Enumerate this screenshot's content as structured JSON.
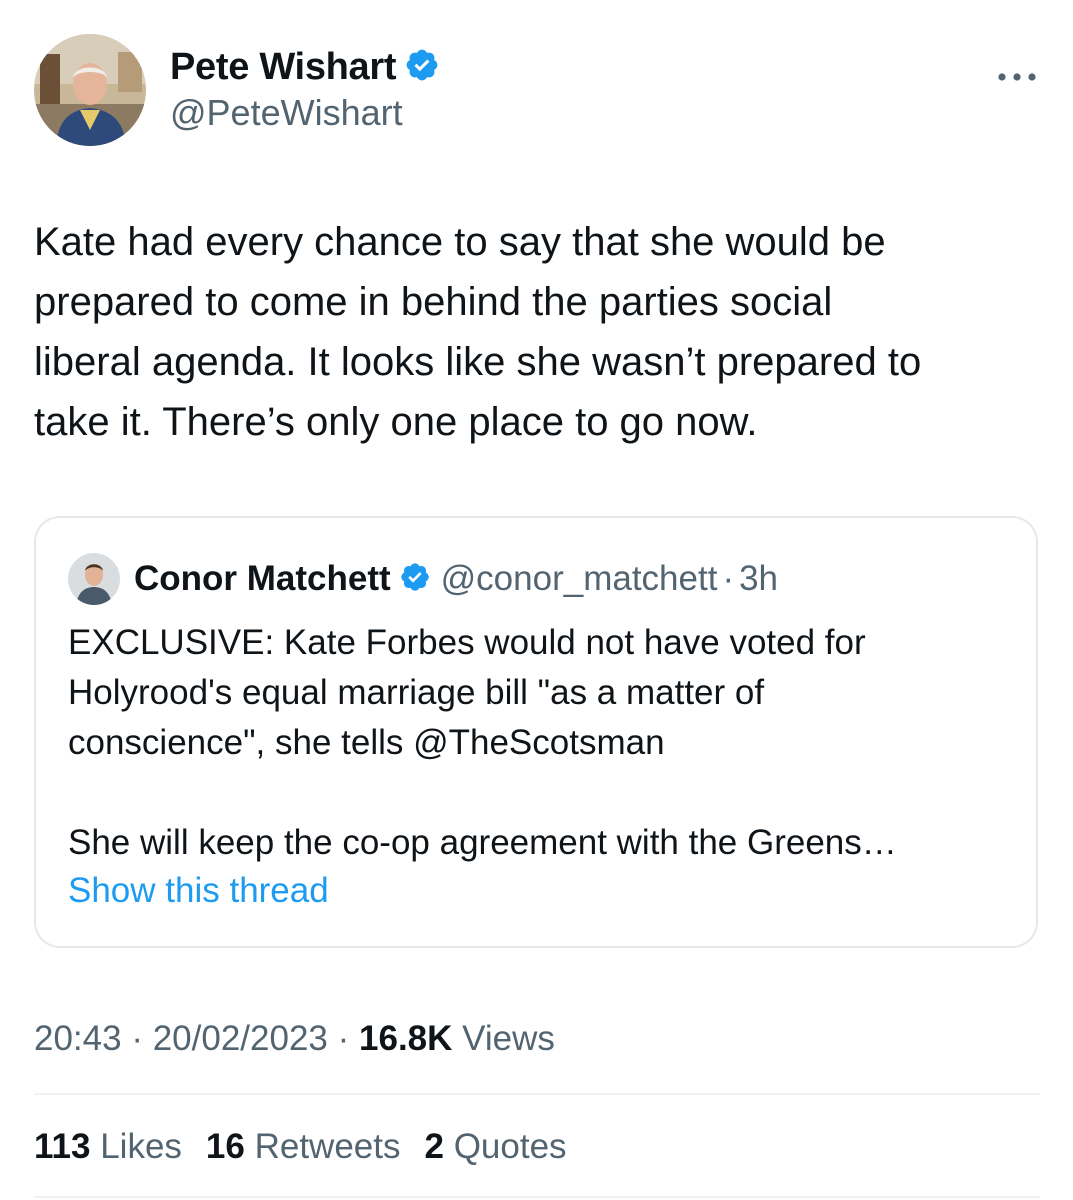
{
  "author": {
    "name": "Pete Wishart",
    "handle": "@PeteWishart",
    "verified": true
  },
  "tweet": {
    "text": "Kate had every chance to say that she would be\nprepared to come in behind the parties social\nliberal agenda. It looks like she wasn’t prepared to\ntake it. There’s only one place to go now."
  },
  "quoted_tweet": {
    "name": "Conor Matchett",
    "handle": "@conor_matchett",
    "separator": "·",
    "time": "3h",
    "verified": true,
    "text": "EXCLUSIVE: Kate Forbes would not have voted for\nHolyrood's equal marriage bill \"as a matter of\nconscience\", she tells @TheScotsman\n\nShe will keep the co-op agreement with the Greens…",
    "show_thread": "Show this thread"
  },
  "meta": {
    "time": "20:43",
    "sep1": "·",
    "date": "20/02/2023",
    "sep2": "·",
    "views_count": "16.8K",
    "views_label": "Views"
  },
  "stats": {
    "likes_count": "113",
    "likes_label": "Likes",
    "retweets_count": "16",
    "retweets_label": "Retweets",
    "quotes_count": "2",
    "quotes_label": "Quotes"
  },
  "icons": {
    "more": "more-icon",
    "verified": "verified-badge-icon"
  },
  "colors": {
    "verified_blue": "#1d9bf0",
    "link_blue": "#1d9bf0",
    "secondary_text": "#536471",
    "primary_text": "#0f1419",
    "border": "#e4e8ec"
  }
}
